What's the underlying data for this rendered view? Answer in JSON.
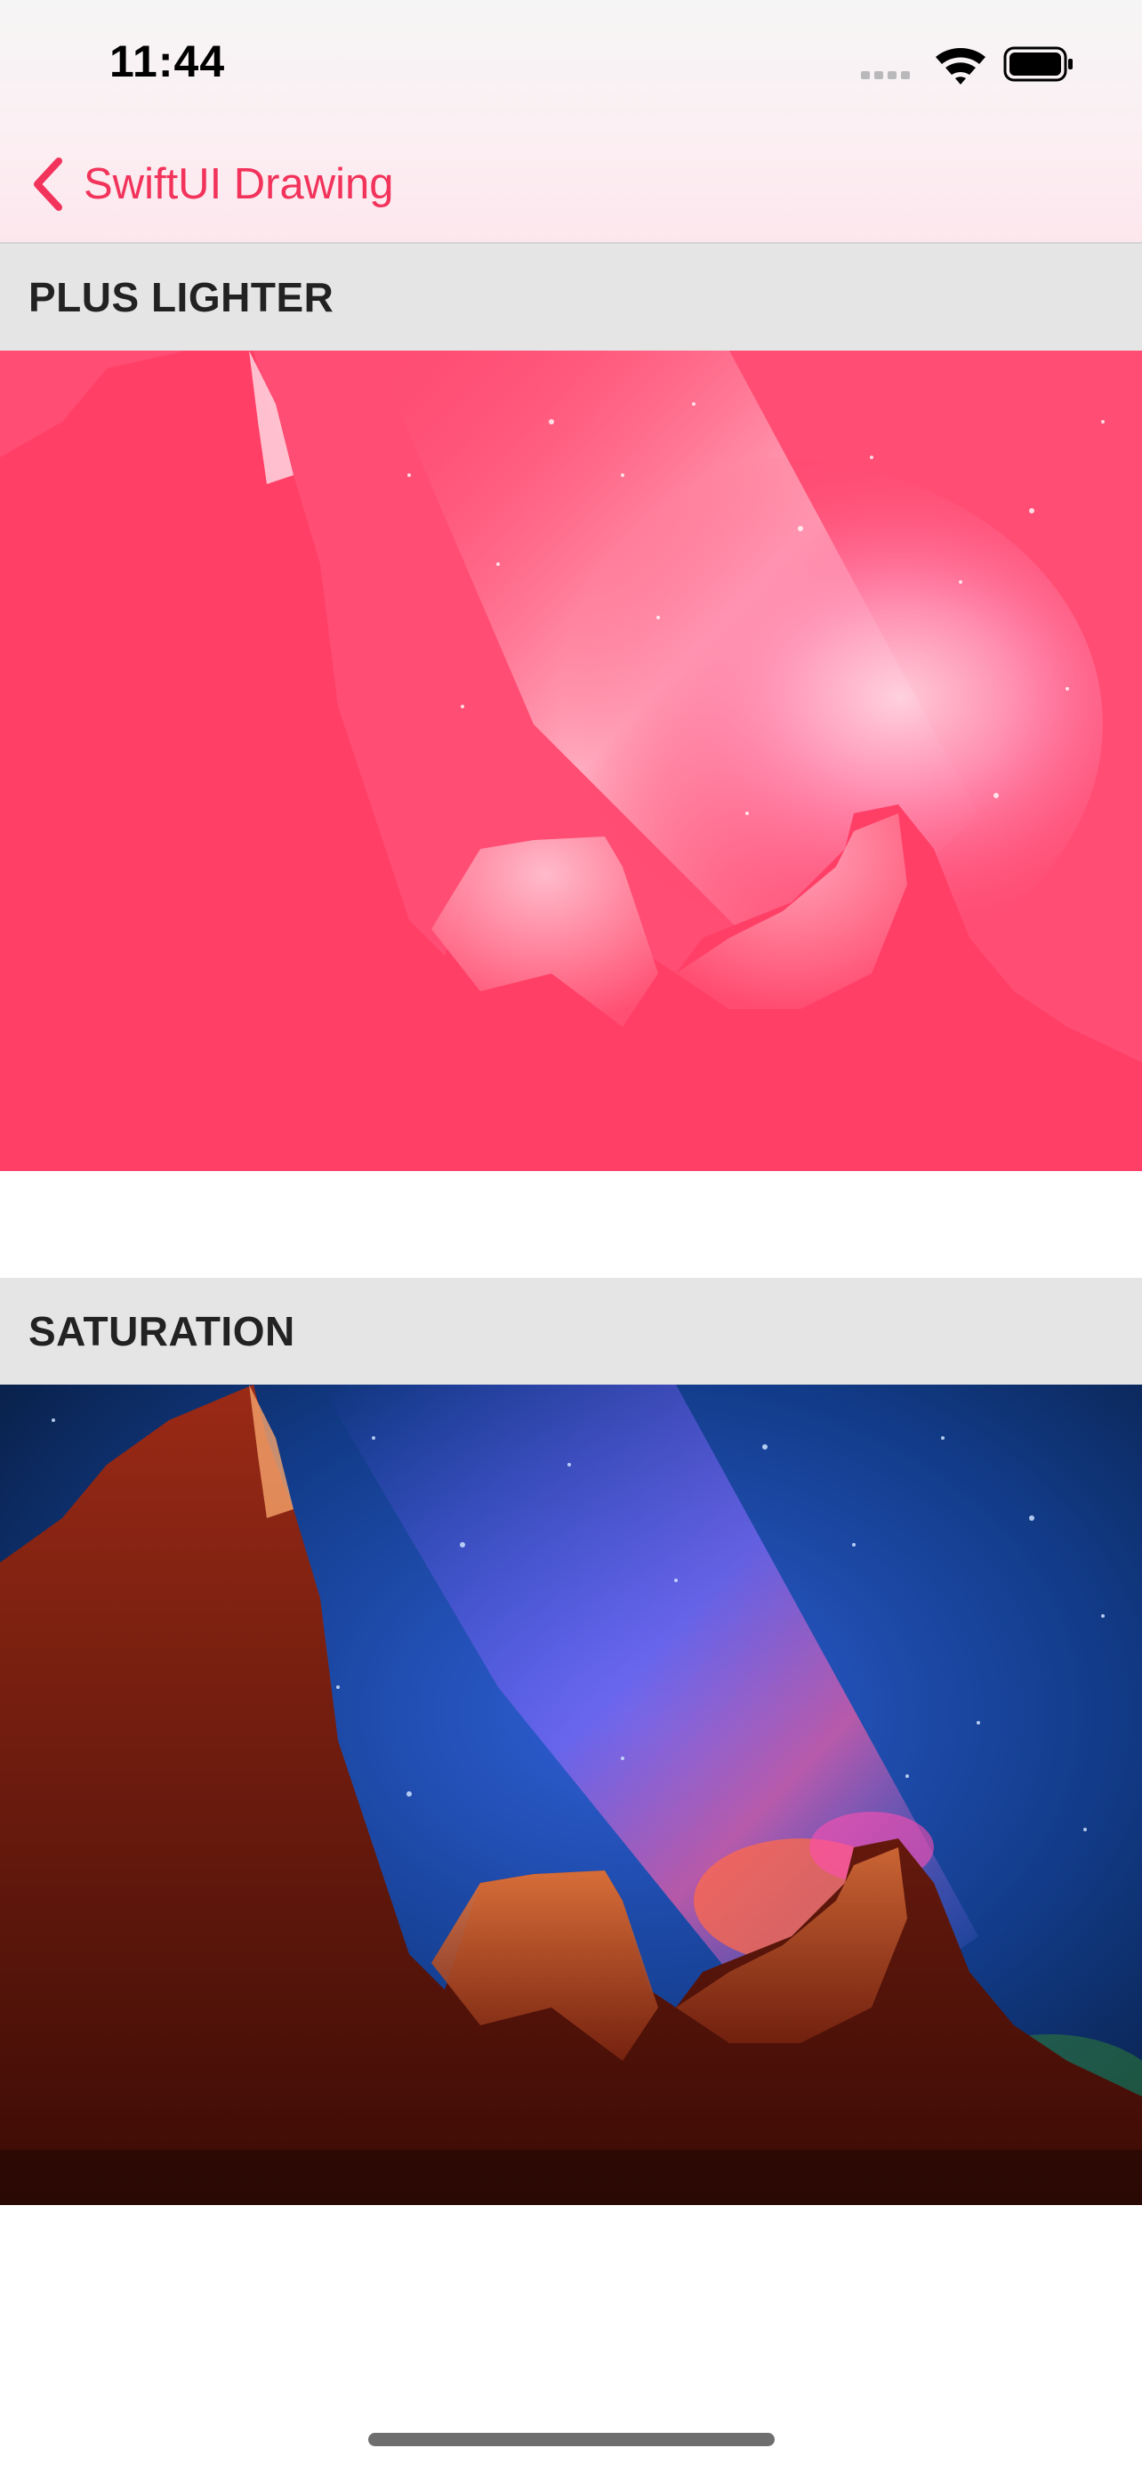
{
  "status_bar": {
    "time": "11:44",
    "icons": [
      "cellular-signal-icon",
      "wifi-icon",
      "battery-icon"
    ]
  },
  "nav": {
    "back_label": "SwiftUI Drawing",
    "back_icon": "chevron-left-icon",
    "accent_color": "#f2335b"
  },
  "sections": [
    {
      "header": "PLUS LIGHTER",
      "blend_mode": "plusLighter",
      "tint_color": "#ff3b5f"
    },
    {
      "header": "SATURATION",
      "blend_mode": "saturation"
    }
  ]
}
